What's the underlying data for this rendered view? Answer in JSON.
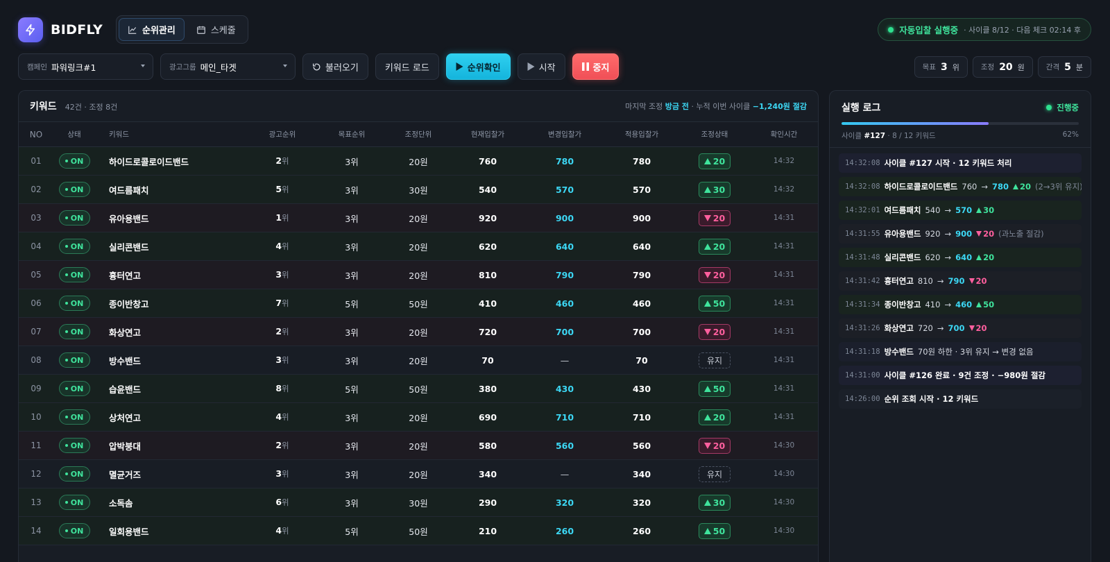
{
  "app": {
    "name": "BIDFLY",
    "accent": "#2fd0f0",
    "up_color": "#3fe39c",
    "down_color": "#ff5f9e"
  },
  "nav": [
    {
      "label": "순위관리",
      "icon": "line-chart-icon",
      "active": true
    },
    {
      "label": "스케줄",
      "icon": "calendar-icon",
      "active": false
    }
  ],
  "status": {
    "label": "자동입찰 실행중",
    "detail": "· 사이클 8/12 · 다음 체크 02:14 후"
  },
  "toolbar": {
    "campaign_label": "캠페인",
    "campaign_value": "파워링크#1",
    "adgroup_label": "광고그룹",
    "adgroup_value": "메인_타겟",
    "reload_label": "불러오기",
    "keyword_load_label": "키워드 로드",
    "rank_check_label": "순위확인",
    "start_label": "시작",
    "stop_label": "중지"
  },
  "settings": {
    "target": {
      "label": "목표",
      "value": "3",
      "unit": "위"
    },
    "adjust": {
      "label": "조정",
      "value": "20",
      "unit": "원"
    },
    "interval": {
      "label": "간격",
      "value": "5",
      "unit": "분"
    }
  },
  "keyword_panel": {
    "title": "키워드",
    "count": "42건 · 조정 8건",
    "meta_prefix": "마지막 조정",
    "meta_time": "방금 전",
    "meta_mid": "· 누적 이번 사이클",
    "meta_saving": "−1,240원 절감",
    "columns": [
      "NO",
      "상태",
      "키워드",
      "광고순위",
      "목표순위",
      "조정단위",
      "현재입찰가",
      "변경입찰가",
      "적용입찰가",
      "조정상태",
      "확인시간"
    ],
    "rank_unit": "위",
    "on_label": "ON",
    "keep_label": "유지",
    "rows": [
      {
        "no": "01",
        "keyword": "하이드로콜로이드밴드",
        "rank": "2",
        "target": "3위",
        "unit": "20원",
        "current": "760",
        "changed": "780",
        "applied": "780",
        "dir": "up",
        "adj": "20",
        "time": "14:32"
      },
      {
        "no": "02",
        "keyword": "여드름패치",
        "rank": "5",
        "target": "3위",
        "unit": "30원",
        "current": "540",
        "changed": "570",
        "applied": "570",
        "dir": "up",
        "adj": "30",
        "time": "14:32"
      },
      {
        "no": "03",
        "keyword": "유아용밴드",
        "rank": "1",
        "target": "3위",
        "unit": "20원",
        "current": "920",
        "changed": "900",
        "applied": "900",
        "dir": "down",
        "adj": "20",
        "time": "14:31"
      },
      {
        "no": "04",
        "keyword": "실리콘밴드",
        "rank": "4",
        "target": "3위",
        "unit": "20원",
        "current": "620",
        "changed": "640",
        "applied": "640",
        "dir": "up",
        "adj": "20",
        "time": "14:31"
      },
      {
        "no": "05",
        "keyword": "흉터연고",
        "rank": "3",
        "target": "3위",
        "unit": "20원",
        "current": "810",
        "changed": "790",
        "applied": "790",
        "dir": "down",
        "adj": "20",
        "time": "14:31"
      },
      {
        "no": "06",
        "keyword": "종이반창고",
        "rank": "7",
        "target": "5위",
        "unit": "50원",
        "current": "410",
        "changed": "460",
        "applied": "460",
        "dir": "up",
        "adj": "50",
        "time": "14:31"
      },
      {
        "no": "07",
        "keyword": "화상연고",
        "rank": "2",
        "target": "3위",
        "unit": "20원",
        "current": "720",
        "changed": "700",
        "applied": "700",
        "dir": "down",
        "adj": "20",
        "time": "14:31"
      },
      {
        "no": "08",
        "keyword": "방수밴드",
        "rank": "3",
        "target": "3위",
        "unit": "20원",
        "current": "70",
        "changed": "—",
        "applied": "70",
        "dir": "keep",
        "adj": "유지",
        "time": "14:31"
      },
      {
        "no": "09",
        "keyword": "습윤밴드",
        "rank": "8",
        "target": "5위",
        "unit": "50원",
        "current": "380",
        "changed": "430",
        "applied": "430",
        "dir": "up",
        "adj": "50",
        "time": "14:31"
      },
      {
        "no": "10",
        "keyword": "상처연고",
        "rank": "4",
        "target": "3위",
        "unit": "20원",
        "current": "690",
        "changed": "710",
        "applied": "710",
        "dir": "up",
        "adj": "20",
        "time": "14:31"
      },
      {
        "no": "11",
        "keyword": "압박붕대",
        "rank": "2",
        "target": "3위",
        "unit": "20원",
        "current": "580",
        "changed": "560",
        "applied": "560",
        "dir": "down",
        "adj": "20",
        "time": "14:30"
      },
      {
        "no": "12",
        "keyword": "멸균거즈",
        "rank": "3",
        "target": "3위",
        "unit": "20원",
        "current": "340",
        "changed": "—",
        "applied": "340",
        "dir": "keep",
        "adj": "유지",
        "time": "14:30"
      },
      {
        "no": "13",
        "keyword": "소독솜",
        "rank": "6",
        "target": "3위",
        "unit": "30원",
        "current": "290",
        "changed": "320",
        "applied": "320",
        "dir": "up",
        "adj": "30",
        "time": "14:30"
      },
      {
        "no": "14",
        "keyword": "일회용밴드",
        "rank": "4",
        "target": "5위",
        "unit": "50원",
        "current": "210",
        "changed": "260",
        "applied": "260",
        "dir": "up",
        "adj": "50",
        "time": "14:30"
      }
    ]
  },
  "log_panel": {
    "title": "실행 로그",
    "state": "진행중",
    "progress": 0.62,
    "cycle_label": "사이클",
    "cycle_value": "#127",
    "cycle_detail": "· 8 / 12 키워드",
    "progress_percent": "62%",
    "items": [
      {
        "type": "info",
        "time": "14:32:08",
        "msg": "사이클 #127 시작 · 12 키워드 처리"
      },
      {
        "type": "up",
        "time": "14:32:08",
        "kw": "하이드로콜로이드밴드",
        "from": "760",
        "to": "780",
        "dir": "up",
        "delta": "20",
        "note": "(2→3위 유지)"
      },
      {
        "type": "up",
        "time": "14:32:01",
        "kw": "여드름패치",
        "from": "540",
        "to": "570",
        "dir": "up",
        "delta": "30",
        "note": ""
      },
      {
        "type": "down",
        "time": "14:31:55",
        "kw": "유아용밴드",
        "from": "920",
        "to": "900",
        "dir": "down",
        "delta": "20",
        "note": "(과노출 절감)"
      },
      {
        "type": "up",
        "time": "14:31:48",
        "kw": "실리콘밴드",
        "from": "620",
        "to": "640",
        "dir": "up",
        "delta": "20",
        "note": ""
      },
      {
        "type": "down",
        "time": "14:31:42",
        "kw": "흉터연고",
        "from": "810",
        "to": "790",
        "dir": "down",
        "delta": "20",
        "note": ""
      },
      {
        "type": "up",
        "time": "14:31:34",
        "kw": "종이반창고",
        "from": "410",
        "to": "460",
        "dir": "up",
        "delta": "50",
        "note": ""
      },
      {
        "type": "down",
        "time": "14:31:26",
        "kw": "화상연고",
        "from": "720",
        "to": "700",
        "dir": "down",
        "delta": "20",
        "note": ""
      },
      {
        "type": "plain-kw",
        "time": "14:31:18",
        "kw": "방수밴드",
        "msg": "70원 하한 · 3위 유지 → 변경 없음"
      },
      {
        "type": "info",
        "time": "14:31:00",
        "msg": "사이클 #126 완료 · 9건 조정 · −980원 절감"
      },
      {
        "type": "plain",
        "time": "14:26:00",
        "msg": "순위 조회 시작 · 12 키워드"
      }
    ]
  }
}
